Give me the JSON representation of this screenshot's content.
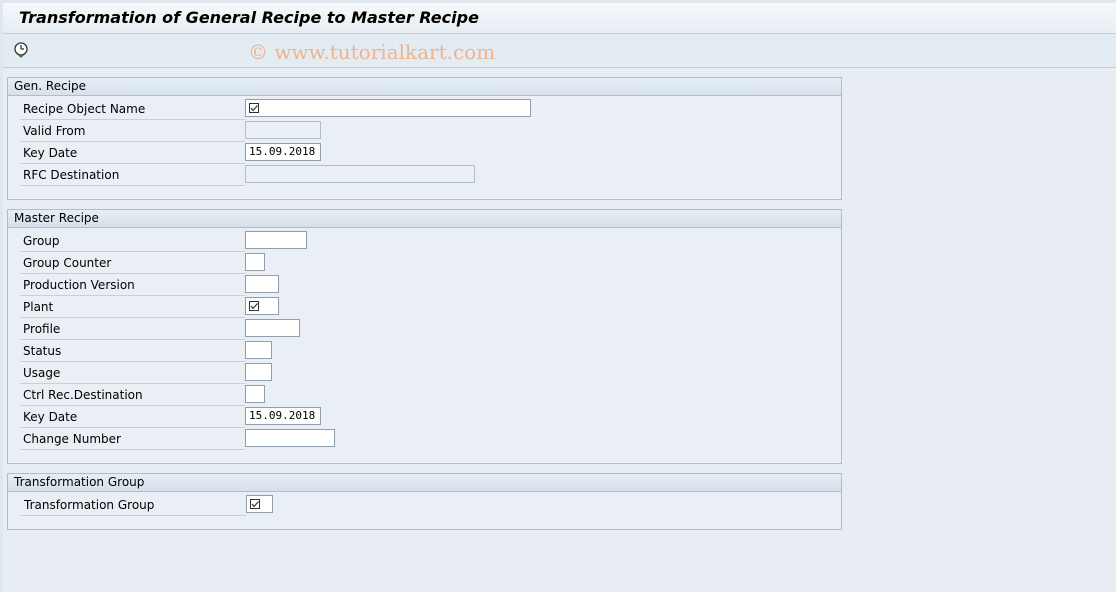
{
  "window": {
    "title": "Transformation of General Recipe to Master Recipe"
  },
  "toolbar": {
    "execute_icon": "execute-clock-icon"
  },
  "watermark": "© www.tutorialkart.com",
  "gen_recipe": {
    "title": "Gen. Recipe",
    "recipe_object_name": {
      "label": "Recipe Object Name",
      "value": ""
    },
    "valid_from": {
      "label": "Valid From",
      "value": ""
    },
    "key_date": {
      "label": "Key Date",
      "value": "15.09.2018"
    },
    "rfc_destination": {
      "label": "RFC Destination",
      "value": ""
    }
  },
  "master_recipe": {
    "title": "Master Recipe",
    "group": {
      "label": "Group",
      "value": ""
    },
    "group_counter": {
      "label": "Group Counter",
      "value": ""
    },
    "production_version": {
      "label": "Production Version",
      "value": ""
    },
    "plant": {
      "label": "Plant",
      "value": ""
    },
    "profile": {
      "label": "Profile",
      "value": ""
    },
    "status": {
      "label": "Status",
      "value": ""
    },
    "usage": {
      "label": "Usage",
      "value": ""
    },
    "ctrl_rec_destination": {
      "label": "Ctrl Rec.Destination",
      "value": ""
    },
    "key_date": {
      "label": "Key Date",
      "value": "15.09.2018"
    },
    "change_number": {
      "label": "Change Number",
      "value": ""
    }
  },
  "transformation_group": {
    "title": "Transformation Group",
    "group": {
      "label": "Transformation Group",
      "value": ""
    }
  }
}
